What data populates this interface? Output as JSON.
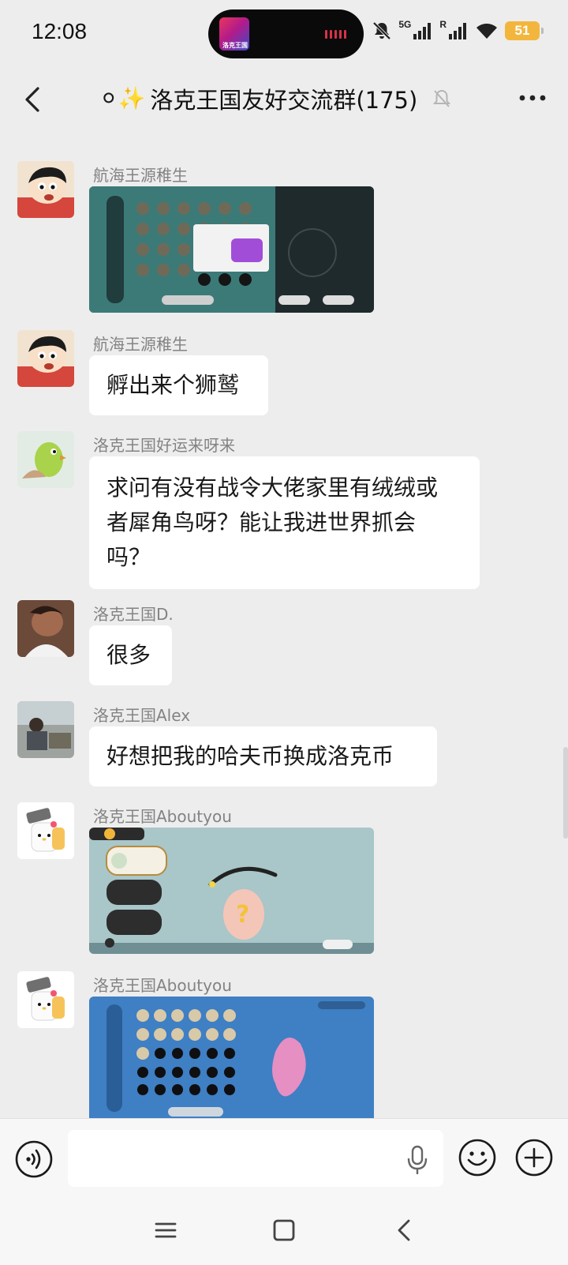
{
  "status_bar": {
    "time": "12:08",
    "island_app_text": "洛克王国",
    "network_5g": "5G",
    "network_r": "R",
    "battery": "51"
  },
  "header": {
    "title": "洛克王国友好交流群(175)",
    "title_prefix": "⚪✨",
    "back_icon": "chevron-left-icon",
    "mute_icon": "bell-off-icon",
    "more_icon": "more-dots-icon"
  },
  "messages": [
    {
      "sender": "航海王源稚生",
      "type": "image",
      "image_desc": "pet-bag-screenshot"
    },
    {
      "sender": "航海王源稚生",
      "type": "text",
      "text": "孵出来个狮鹫"
    },
    {
      "sender": "洛克王国好运来呀来",
      "type": "text",
      "lines": [
        "求问有没有战令大佬家里有绒绒或",
        "者犀角鸟呀？能让我进世界抓会",
        "吗？"
      ]
    },
    {
      "sender": "洛克王国D.",
      "type": "text",
      "text": "很多"
    },
    {
      "sender": "洛克王国Alex",
      "type": "text",
      "text": "好想把我的哈夫币换成洛克币"
    },
    {
      "sender": "洛克王国Aboutyou",
      "type": "image",
      "image_desc": "egg-hatching-screenshot"
    },
    {
      "sender": "洛克王国Aboutyou",
      "type": "image",
      "image_desc": "pet-bag-screenshot-blue"
    }
  ],
  "input_bar": {
    "placeholder": "",
    "value": ""
  },
  "nav_bar": {
    "menu_icon": "menu-icon",
    "home_icon": "home-square-icon",
    "back_icon": "back-triangle-icon"
  },
  "colors": {
    "background": "#ededed",
    "bubble": "#ffffff",
    "sender_name": "#838383",
    "battery": "#f3b63c"
  }
}
